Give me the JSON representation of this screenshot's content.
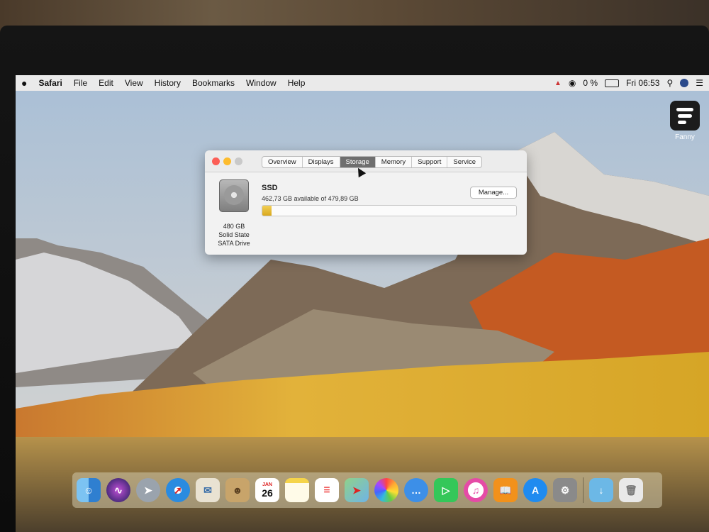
{
  "menubar": {
    "apple": "",
    "app_name": "Safari",
    "items": [
      "File",
      "Edit",
      "View",
      "History",
      "Bookmarks",
      "Window",
      "Help"
    ],
    "battery_percent": "0 %",
    "clock": "Fri 06:53"
  },
  "desktop_icon": {
    "label": "Fanny"
  },
  "about_window": {
    "tabs": [
      "Overview",
      "Displays",
      "Storage",
      "Memory",
      "Support",
      "Service"
    ],
    "selected_tab": "Storage",
    "drive": {
      "capacity": "480 GB",
      "type_line1": "Solid State",
      "type_line2": "SATA Drive",
      "name": "SSD",
      "available": "462,73 GB available of 479,89 GB",
      "used_fraction": 0.036
    },
    "manage_button": "Manage..."
  },
  "dock": {
    "calendar_month": "JAN",
    "calendar_day": "26",
    "apps": [
      "finder-icon",
      "siri-icon",
      "launchpad-icon",
      "safari-icon",
      "mail-icon",
      "contacts-icon",
      "calendar-icon",
      "notes-icon",
      "reminders-icon",
      "maps-icon",
      "photos-icon",
      "messages-icon",
      "facetime-icon",
      "itunes-icon",
      "books-icon",
      "app-store-icon",
      "system-preferences-icon",
      "downloads-folder-icon",
      "trash-icon"
    ]
  },
  "colors": {
    "storage_bar": "#e0b32a",
    "selected_tab": "#6e6e6e",
    "close": "#fc5f57",
    "minimize": "#fdbc2e",
    "zoom": "#c9c9c9"
  }
}
